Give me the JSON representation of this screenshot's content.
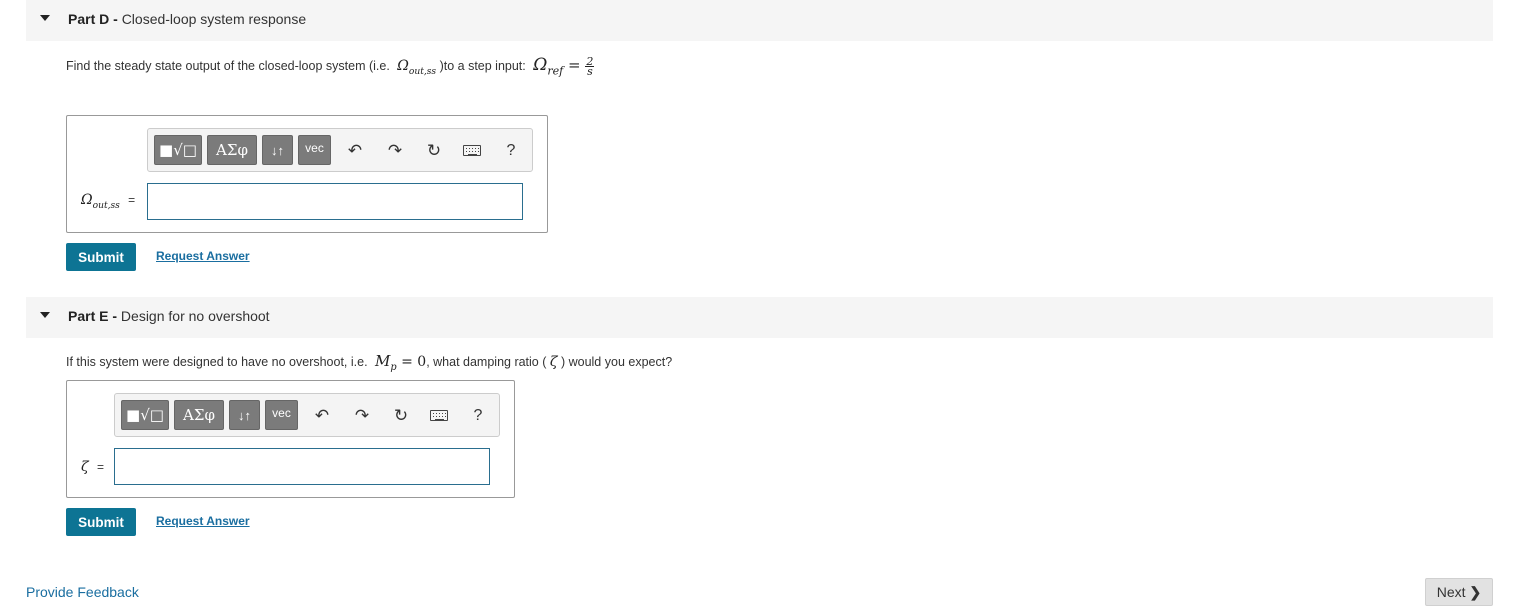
{
  "parts": [
    {
      "label": "Part D",
      "separator": " - ",
      "title": "Closed-loop system response",
      "question_text": "Find the steady state output of the closed-loop system (i.e.",
      "question_math_symbol": "Ω",
      "question_math_sub": "out,ss",
      "question_text_2": ")to a step input:",
      "question_math_2": "Ω",
      "question_math_2_sub": "ref",
      "question_math_2_eq": " = ",
      "question_frac_num": "2",
      "question_frac_den": "s",
      "variable_symbol": "Ω",
      "variable_sub": "out,ss",
      "variable_eq": "=",
      "answer_value": "",
      "submit_label": "Submit",
      "request_label": "Request Answer"
    },
    {
      "label": "Part E",
      "separator": " - ",
      "title": "Design for no overshoot",
      "question_text": "If this system were designed to have no overshoot, i.e.",
      "question_math": "M",
      "question_math_sub": "p",
      "question_math_eq": " = 0",
      "question_text_2": ", what damping ratio (",
      "question_math_2": "ζ",
      "question_text_3": ") would you expect?",
      "variable_symbol": "ζ",
      "variable_eq": "=",
      "answer_value": "",
      "submit_label": "Submit",
      "request_label": "Request Answer"
    }
  ],
  "toolbar": {
    "templates_label": "■√□",
    "greek_label": "ΑΣφ",
    "arrows_label": "↓↑",
    "vec_label": "vec",
    "undo_icon": "↶",
    "redo_icon": "↷",
    "reset_icon": "↻",
    "help_label": "?"
  },
  "footer": {
    "feedback_label": "Provide Feedback",
    "next_label": "Next",
    "next_chevron": "❯"
  }
}
